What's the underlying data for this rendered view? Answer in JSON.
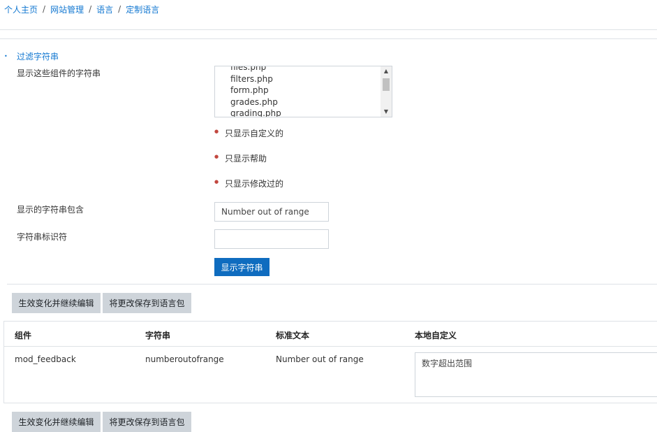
{
  "breadcrumb": [
    "个人主页",
    "网站管理",
    "语言",
    "定制语言"
  ],
  "filter": {
    "section_title": "过滤字符串",
    "components_label": "显示这些组件的字符串",
    "components_options": [
      "files.php",
      "filters.php",
      "form.php",
      "grades.php",
      "grading.php"
    ],
    "checkbox_customized": "只显示自定义的",
    "checkbox_help": "只显示帮助",
    "checkbox_modified": "只显示修改过的",
    "contains_label": "显示的字符串包含",
    "contains_value": "Number out of range",
    "identifier_label": "字符串标识符",
    "identifier_value": "",
    "show_button": "显示字符串"
  },
  "actions": {
    "apply_continue": "生效变化并继续编辑",
    "save_to_pack": "将更改保存到语言包"
  },
  "table": {
    "headers": [
      "组件",
      "字符串",
      "标准文本",
      "本地自定义"
    ],
    "rows": [
      {
        "component": "mod_feedback",
        "string": "numberoutofrange",
        "standard": "Number out of range",
        "local": "数字超出范围"
      }
    ]
  },
  "colors": {
    "link": "#1177d1",
    "primary": "#0f6cbf",
    "secondary": "#ced4da",
    "required_dot": "#c2473f"
  }
}
